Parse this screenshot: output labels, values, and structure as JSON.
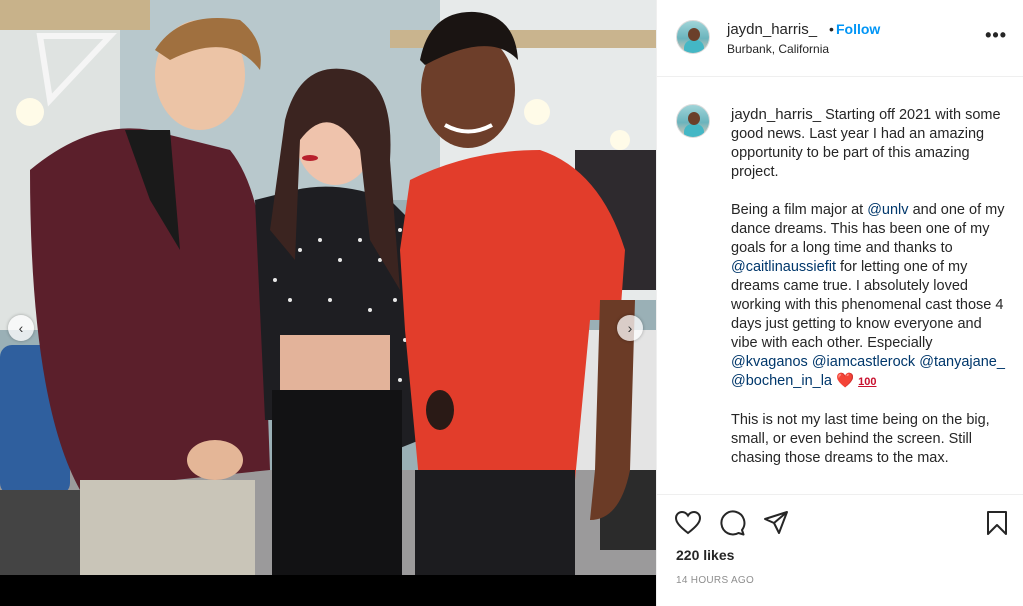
{
  "post": {
    "username": "jaydn_harris_",
    "follow_separator": "•",
    "follow_label": "Follow",
    "location": "Burbank, California",
    "more_label": "•••",
    "nav_prev": "‹",
    "nav_next": "›"
  },
  "caption": {
    "username": "jaydn_harris_",
    "p1": "Starting off 2021 with some good news. Last year I had an amazing opportunity to be part of this amazing project.",
    "p2_a": "Being a film major at",
    "m_unlv": "@unlv",
    "p2_b": "and one of my dance dreams. This has been one of my goals for a long time and thanks to",
    "m_caitlin": "@caitlinaussiefit",
    "p2_c": "for letting one of my dreams came true. I absolutely loved working with this phenomenal cast those 4 days just getting to know everyone and vibe with each other. Especially",
    "m_kvaganos": "@kvaganos",
    "m_iamcastlerock": "@iamcastlerock",
    "m_tanyajane": "@tanyajane_",
    "m_bochen": "@bochen_in_la",
    "emoji_heart": "❤️",
    "emoji_100": "100",
    "p3": "This is not my last time being on the big, small, or even behind the screen. Still chasing those dreams to the max."
  },
  "engagement": {
    "likes": "220 likes",
    "timestamp": "14 HOURS AGO"
  },
  "icons": [
    "heart-icon",
    "comment-icon",
    "share-icon",
    "bookmark-icon",
    "more-icon",
    "chevron-left-icon",
    "chevron-right-icon"
  ],
  "colors": {
    "follow": "#0095f6",
    "mention": "#00376b",
    "text": "#262626",
    "muted": "#8e8e8e",
    "heart": "#d81b3a"
  }
}
